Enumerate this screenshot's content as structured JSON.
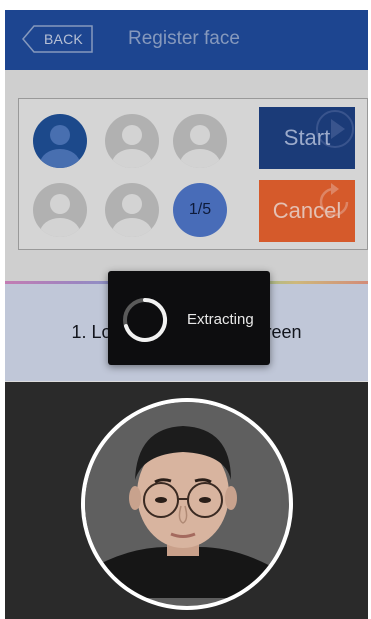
{
  "header": {
    "back_label": "BACK",
    "title": "Register face"
  },
  "capture": {
    "progress_label": "1/5",
    "captured": 1,
    "total": 5
  },
  "buttons": {
    "start_label": "Start",
    "cancel_label": "Cancel"
  },
  "instruction": "1. Look directly at the screen",
  "loading": {
    "text": "Extracting"
  },
  "colors": {
    "header": "#1f4a99",
    "start": "#1d3f80",
    "cancel": "#e3602e",
    "avatar_active": "#1e4e94",
    "counter": "#4d73c4"
  }
}
